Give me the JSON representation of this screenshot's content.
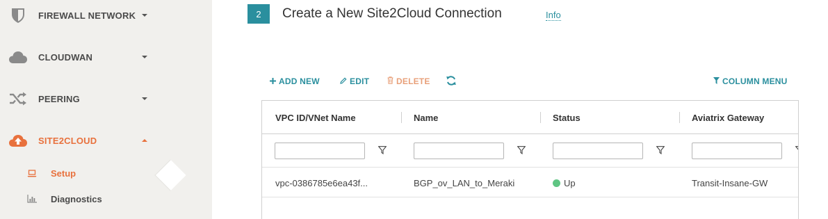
{
  "sidebar": {
    "items": [
      {
        "label": "FIREWALL NETWORK",
        "icon": "shield-icon"
      },
      {
        "label": "CLOUDWAN",
        "icon": "cloud-icon"
      },
      {
        "label": "PEERING",
        "icon": "shuffle-icon"
      },
      {
        "label": "SITE2CLOUD",
        "icon": "cloud-upload-icon",
        "active": true
      }
    ],
    "sub_items": [
      {
        "label": "Setup",
        "icon": "laptop-icon",
        "active": true
      },
      {
        "label": "Diagnostics",
        "icon": "bar-chart-icon"
      }
    ]
  },
  "step": {
    "number": "2",
    "title": "Create a New Site2Cloud Connection",
    "info_label": "Info"
  },
  "toolbar": {
    "add_label": "ADD NEW",
    "edit_label": "EDIT",
    "delete_label": "DELETE",
    "column_menu_label": "COLUMN MENU"
  },
  "table": {
    "columns": [
      "VPC ID/VNet Name",
      "Name",
      "Status",
      "Aviatrix Gateway"
    ],
    "rows": [
      {
        "vpc": "vpc-0386785e6ea43f...",
        "name": "BGP_ov_LAN_to_Meraki",
        "status": "Up",
        "gateway": "Transit-Insane-GW"
      }
    ]
  },
  "colors": {
    "accent": "#2a8f9e",
    "active": "#e8713d",
    "status_up": "#5fc583",
    "delete": "#e8a07a"
  }
}
